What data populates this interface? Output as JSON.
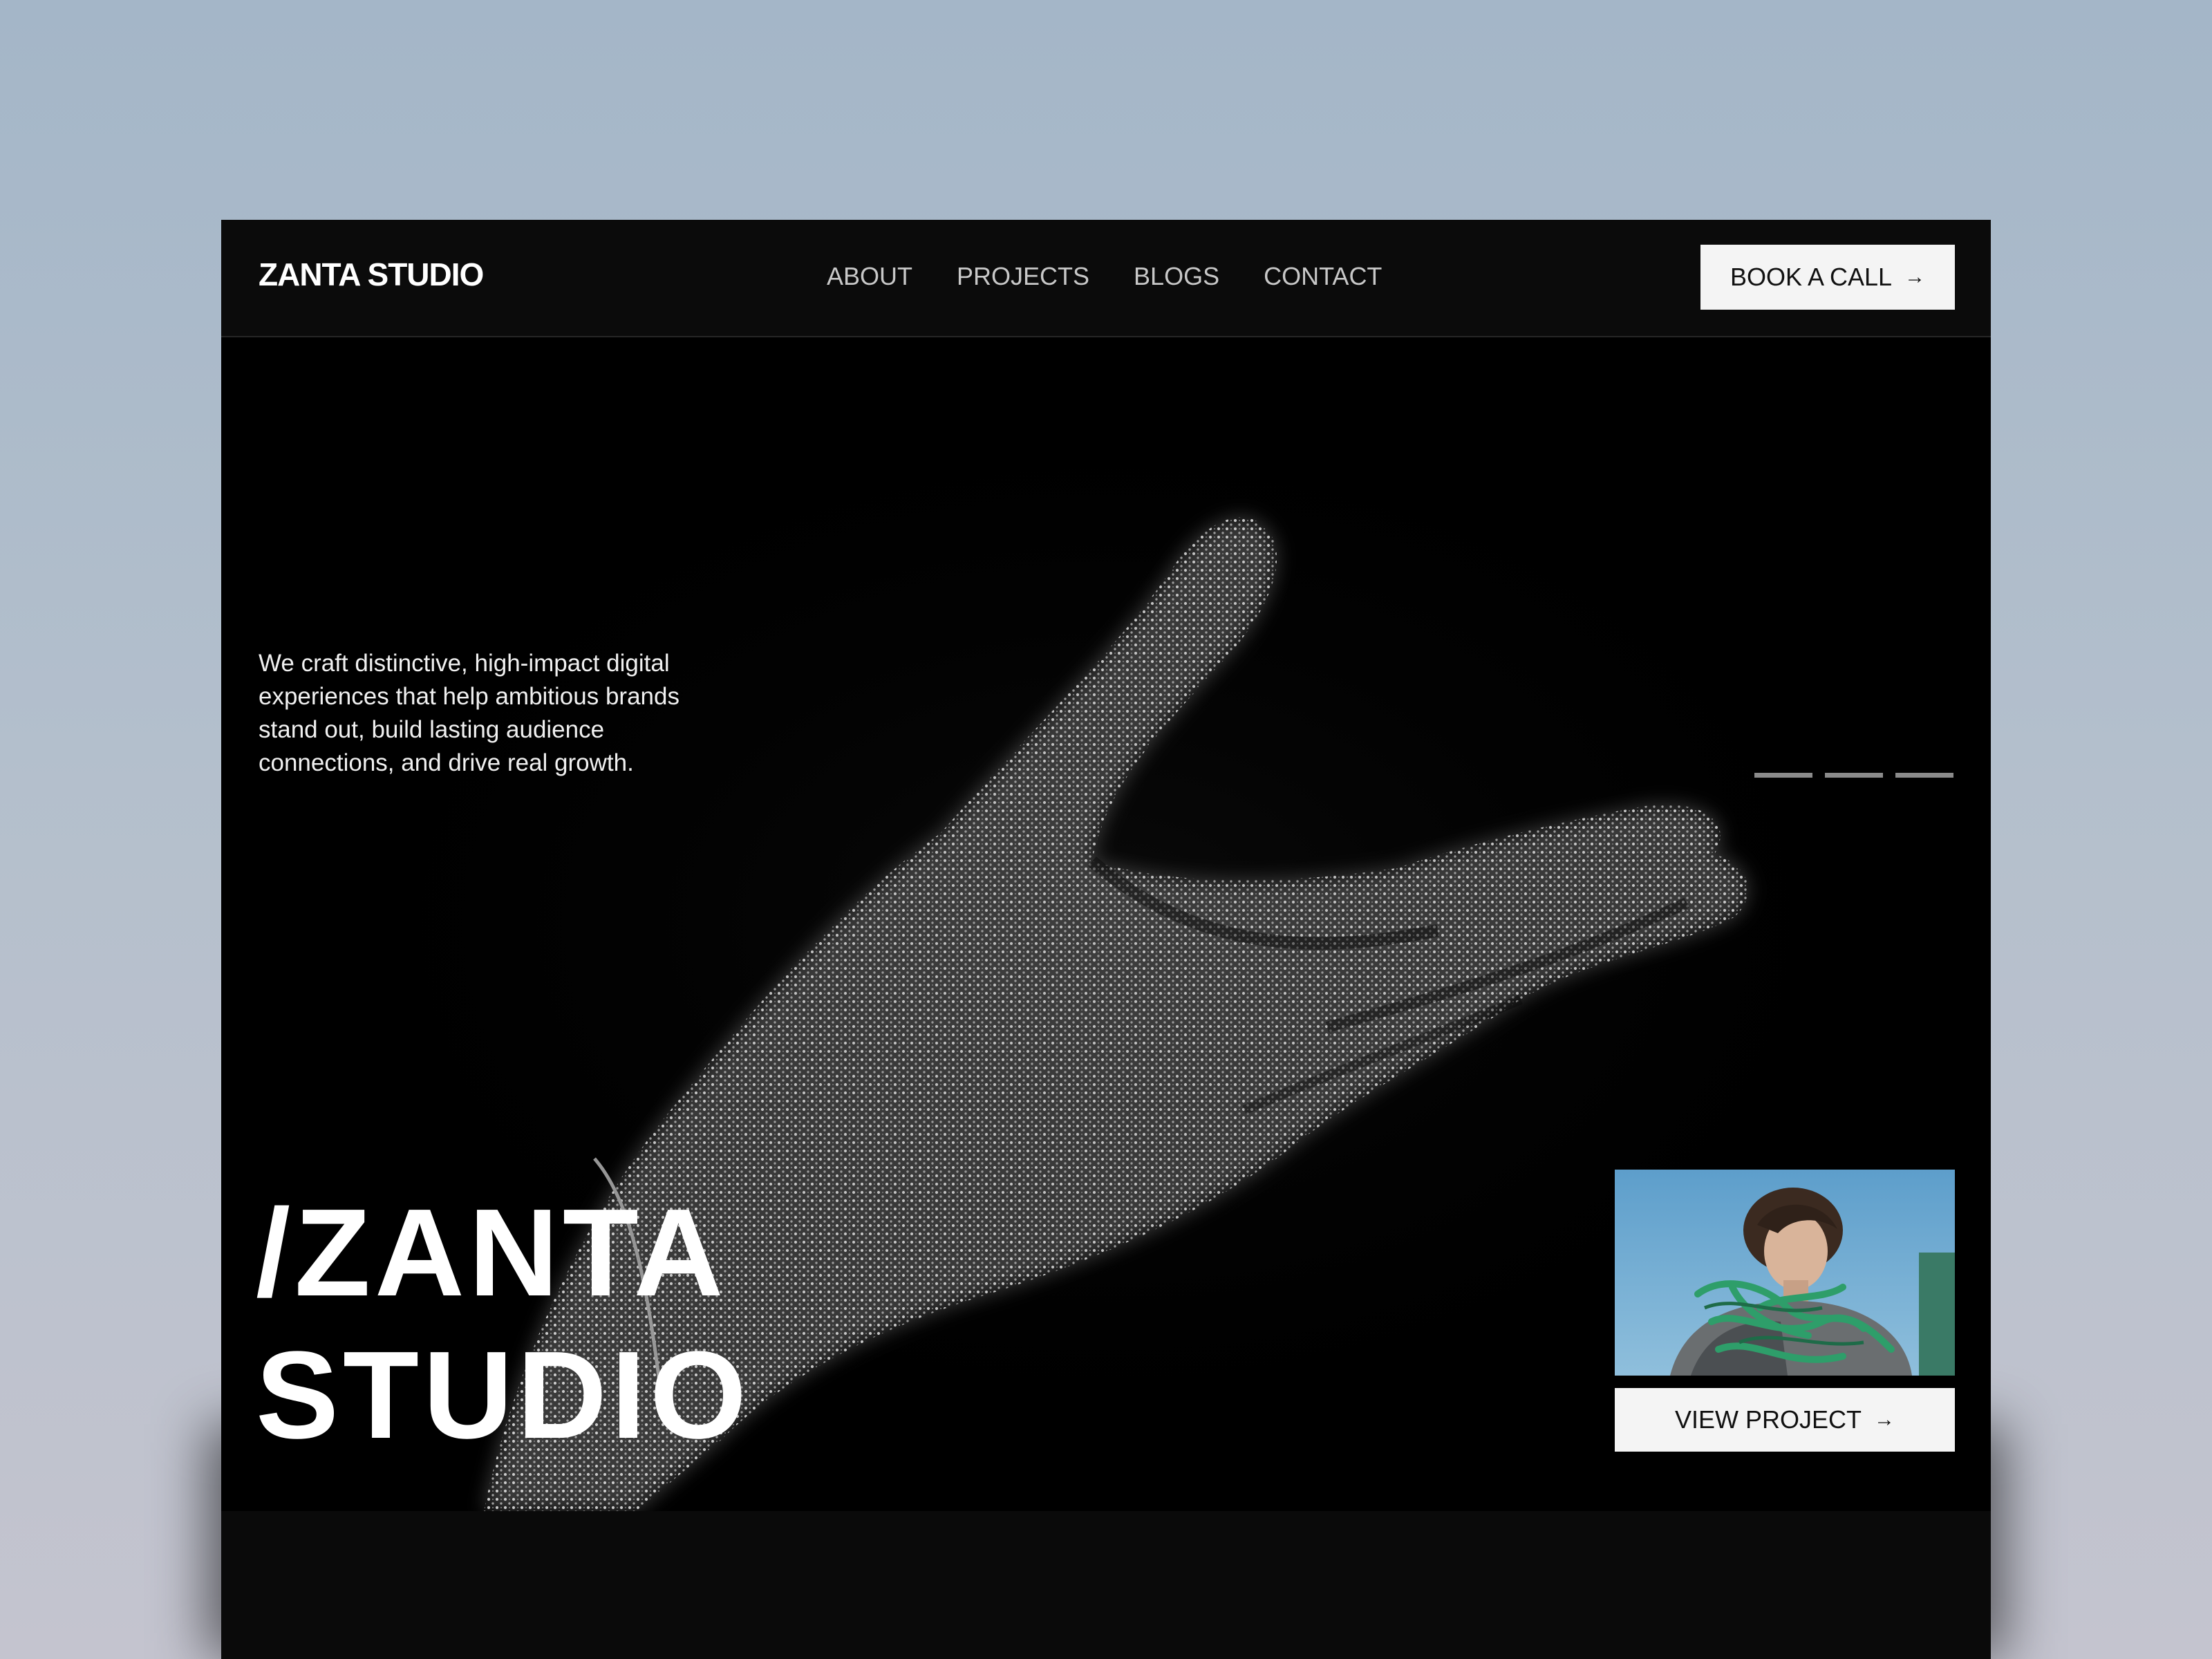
{
  "nav": {
    "logo": "ZANTA STUDIO",
    "items": [
      "ABOUT",
      "PROJECTS",
      "BLOGS",
      "CONTACT"
    ],
    "cta_label": "BOOK A CALL",
    "cta_icon": "arrow-right-icon"
  },
  "hero": {
    "intro": "We craft distinctive, high-impact digital experiences that help ambitious brands stand out, build lasting audience connections, and drive real growth.",
    "title_line1": "/ZANTA",
    "title_line2": "STUDIO",
    "slider_count": 3,
    "project_button_label": "VIEW PROJECT",
    "project_button_icon": "arrow-right-icon"
  },
  "colors": {
    "background": "#000000",
    "nav_background": "#0b0b0b",
    "button_background": "#f4f4f4",
    "text": "#ffffff",
    "thumbnail_sky": "#5d9ecb",
    "thumbnail_rope": "#2e9e6a"
  }
}
